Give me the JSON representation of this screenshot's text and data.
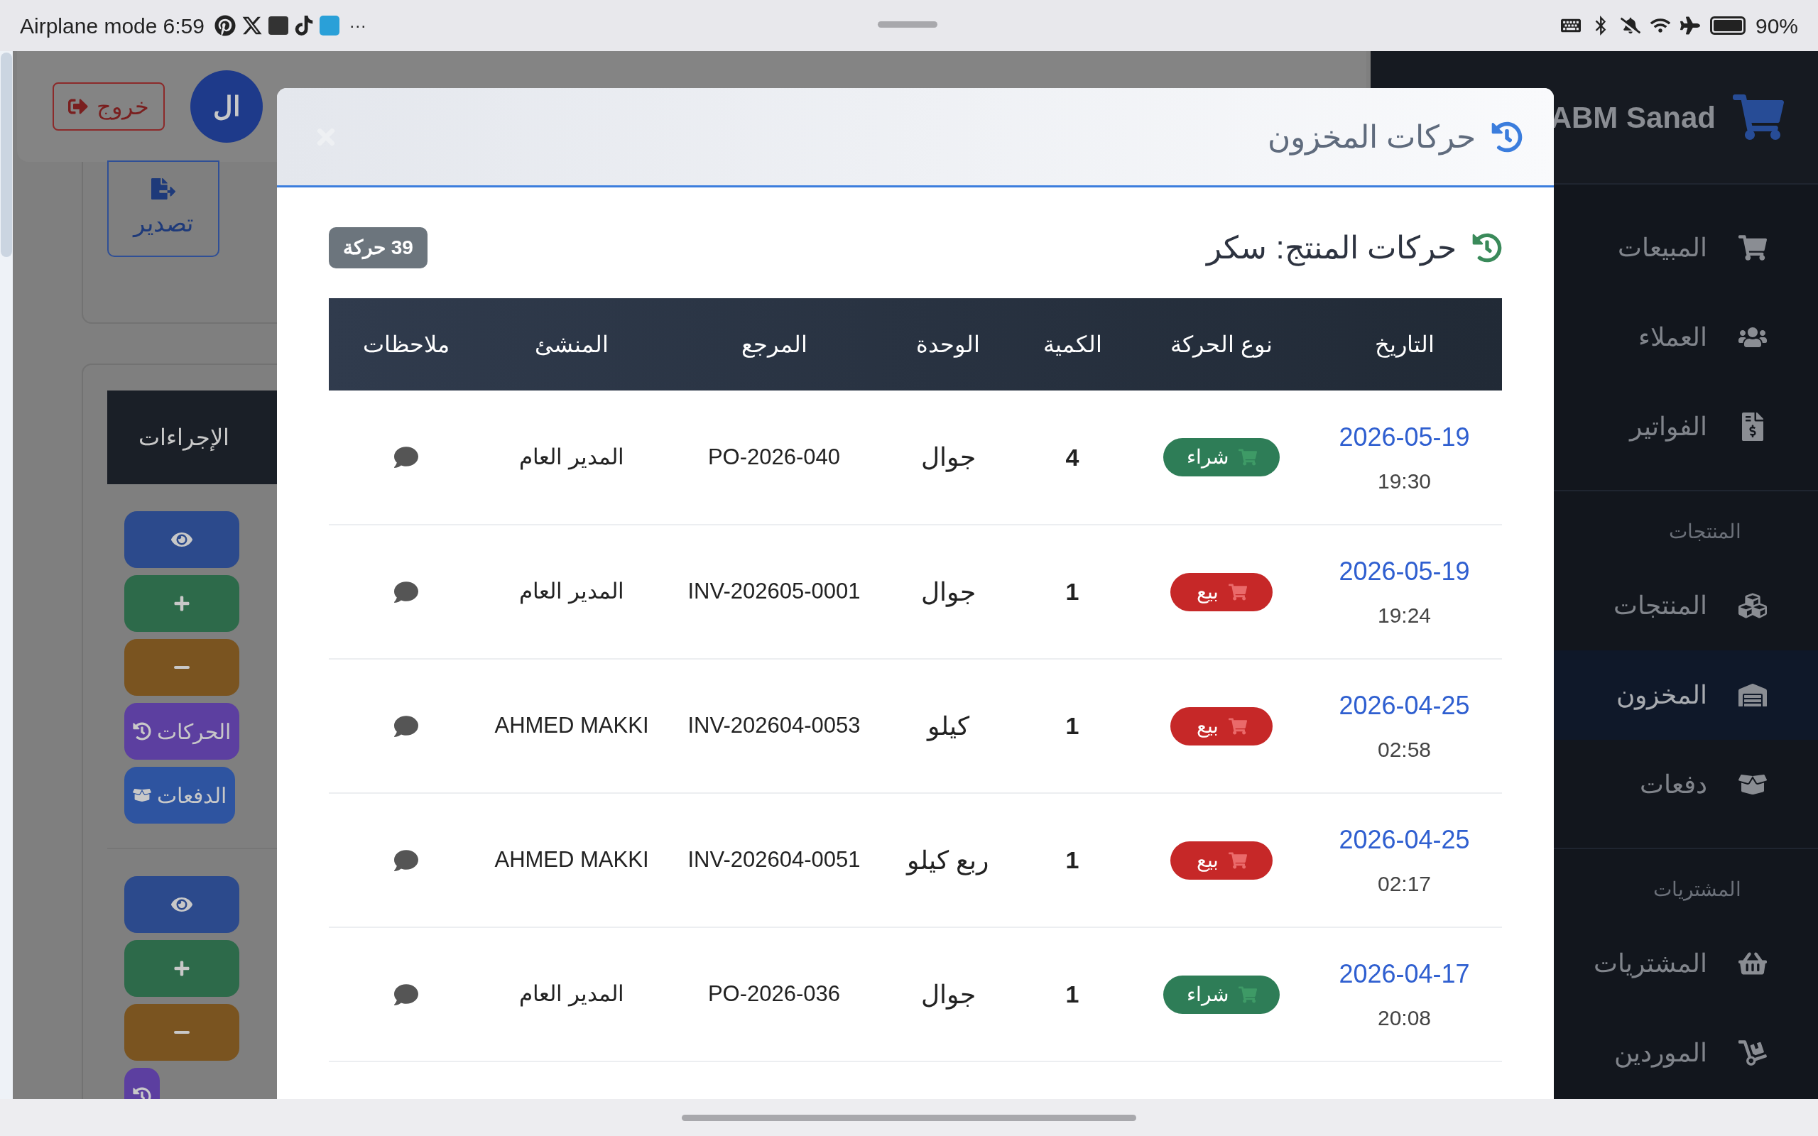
{
  "status_bar": {
    "mode": "Airplane mode",
    "time": "6:59",
    "more": "···",
    "battery": "90%"
  },
  "header": {
    "logout": "خروج",
    "avatar": "ال"
  },
  "export_button": "تصدير",
  "actions_table": {
    "column": "الإجراءات",
    "rows": [
      {
        "buttons": [
          {
            "kind": "view"
          },
          {
            "kind": "add"
          },
          {
            "kind": "subtract"
          },
          {
            "kind": "movements",
            "label": "الحركات"
          },
          {
            "kind": "payments",
            "label": "الدفعات"
          }
        ]
      },
      {
        "buttons": [
          {
            "kind": "view"
          },
          {
            "kind": "add"
          },
          {
            "kind": "subtract"
          },
          {
            "kind": "movements"
          }
        ]
      }
    ]
  },
  "sidebar": {
    "brand": "ABM Sanad",
    "sections": [
      {
        "items": [
          {
            "label": "المبيعات",
            "selected": false
          },
          {
            "label": "العملاء",
            "selected": false
          },
          {
            "label": "الفواتير",
            "selected": false
          }
        ]
      },
      {
        "title": "المنتجات",
        "items": [
          {
            "label": "المنتجات",
            "selected": false
          },
          {
            "label": "المخزون",
            "selected": true
          },
          {
            "label": "دفعات",
            "selected": false
          }
        ]
      },
      {
        "title": "المشتريات",
        "items": [
          {
            "label": "المشتريات",
            "selected": false
          },
          {
            "label": "الموردين",
            "selected": false
          }
        ]
      }
    ]
  },
  "modal": {
    "title": "حركات المخزون",
    "subtitle": "حركات المنتج: سكر",
    "count_badge": "39 حركة",
    "columns": [
      "التاريخ",
      "نوع الحركة",
      "الكمية",
      "الوحدة",
      "المرجع",
      "المنشئ",
      "ملاحظات"
    ],
    "rows": [
      {
        "date": "2026-05-19",
        "time": "19:30",
        "type": {
          "kind": "purchase",
          "label": "شراء"
        },
        "quantity": "4",
        "unit": "جوال",
        "reference": "PO-2026-040",
        "creator": "المدير العام"
      },
      {
        "date": "2026-05-19",
        "time": "19:24",
        "type": {
          "kind": "sale",
          "label": "بيع"
        },
        "quantity": "1",
        "unit": "جوال",
        "reference": "INV-202605-0001",
        "creator": "المدير العام"
      },
      {
        "date": "2026-04-25",
        "time": "02:58",
        "type": {
          "kind": "sale",
          "label": "بيع"
        },
        "quantity": "1",
        "unit": "كيلو",
        "reference": "INV-202604-0053",
        "creator": "AHMED MAKKI"
      },
      {
        "date": "2026-04-25",
        "time": "02:17",
        "type": {
          "kind": "sale",
          "label": "بيع"
        },
        "quantity": "1",
        "unit": "ربع كيلو",
        "reference": "INV-202604-0051",
        "creator": "AHMED MAKKI"
      },
      {
        "date": "2026-04-17",
        "time": "20:08",
        "type": {
          "kind": "purchase",
          "label": "شراء"
        },
        "quantity": "1",
        "unit": "جوال",
        "reference": "PO-2026-036",
        "creator": "المدير العام"
      }
    ]
  }
}
